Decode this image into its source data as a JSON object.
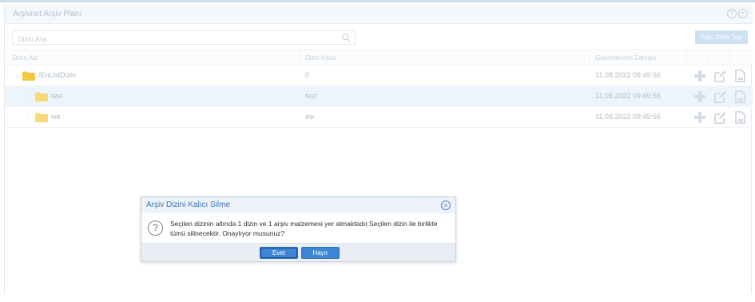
{
  "window": {
    "title": "Arşivnet Arşiv Planı"
  },
  "toolbar": {
    "search_placeholder": "Dizin Ara",
    "top_button_label": "Topu Dizin Tayı"
  },
  "grid": {
    "columns": [
      "Dizin Adı",
      "Dizin Kodu",
      "Güncellenme Zamanı"
    ],
    "rows": [
      {
        "name": "/EnUstDizin",
        "code": "0",
        "updated": "11.08.2022 09:49:56",
        "expanded": true
      },
      {
        "name": "test",
        "code": "test",
        "updated": "11.08.2022 09:49:56",
        "expanded": false
      },
      {
        "name": "we",
        "code": "ew",
        "updated": "11.08.2022 09:49:56",
        "expanded": false
      }
    ]
  },
  "dialog": {
    "title": "Arşiv Dizini Kalıcı Silme",
    "message": "Seçilen dizinin altında 1 dizin ve 1 arşiv malzemesi yer almaktadır.Seçilen dizin ile birlikte tümü silinecektir. Onaylıyor musunuz?",
    "yes_label": "Evet",
    "no_label": "Hayır"
  },
  "icons": {
    "header": [
      "help-icon",
      "close-icon"
    ],
    "row_actions": [
      "add-icon",
      "edit-icon",
      "delete-icon"
    ],
    "folder": "folder-icon"
  },
  "colors": {
    "accent": "#3d86d6",
    "folder": "#f6c744",
    "selected_row": "#eef4fb"
  }
}
